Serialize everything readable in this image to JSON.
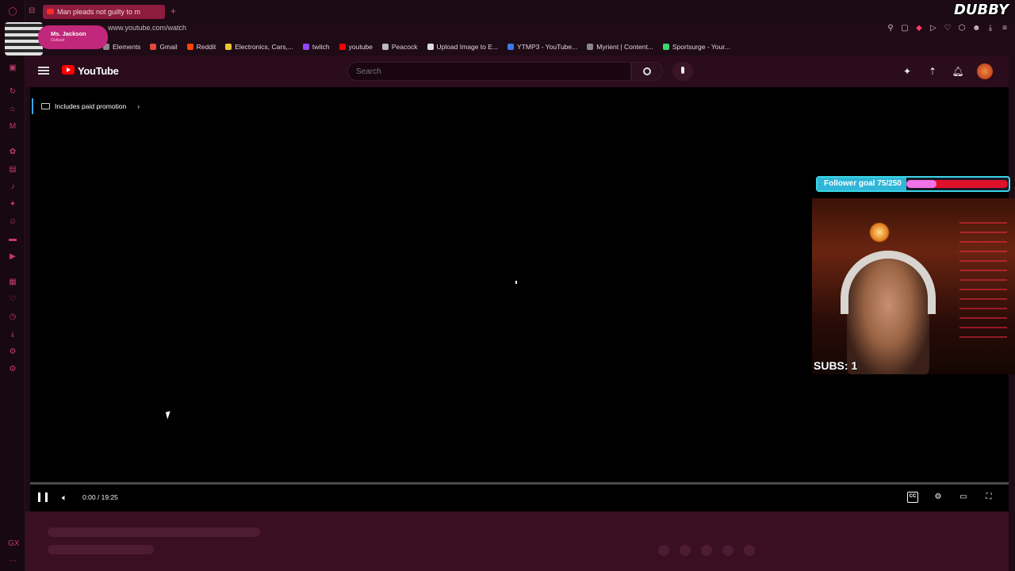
{
  "browser": {
    "tab_title": "Man pleads not guilty to m",
    "url": "www.youtube.com/watch",
    "brand_overlay": "DUBBY"
  },
  "bookmarks": [
    {
      "label": "Elements",
      "color": "#8a8a8a"
    },
    {
      "label": "Gmail",
      "color": "#e04a3a"
    },
    {
      "label": "Reddit",
      "color": "#ff4500"
    },
    {
      "label": "Electronics, Cars,...",
      "color": "#e8c830"
    },
    {
      "label": "twitch",
      "color": "#9146ff"
    },
    {
      "label": "youtube",
      "color": "#ff0000"
    },
    {
      "label": "Peacock",
      "color": "#bbbbbb"
    },
    {
      "label": "Upload Image to E...",
      "color": "#dddddd"
    },
    {
      "label": "YTMP3 - YouTube...",
      "color": "#3a7ae8"
    },
    {
      "label": "Myrient | Content...",
      "color": "#888888"
    },
    {
      "label": "Sportsurge - Your...",
      "color": "#3ad66a"
    }
  ],
  "profile_overlay": {
    "name": "Ms. Jackson",
    "sub": "Outkast"
  },
  "youtube": {
    "logo_text": "YouTube",
    "search_placeholder": "Search",
    "paid_promotion": "Includes paid promotion"
  },
  "player": {
    "time": "0:00 / 19:25",
    "progress": 0
  },
  "stream": {
    "follower_goal": "Follower goal 75/250",
    "follower_progress": 0.3,
    "subs": "SUBS: 1"
  }
}
